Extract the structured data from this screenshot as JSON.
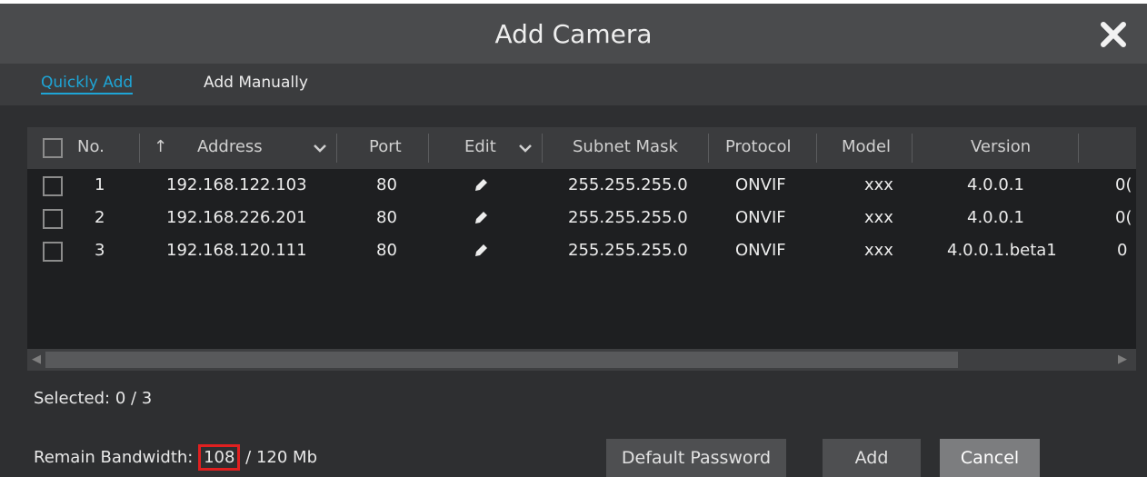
{
  "dialog": {
    "title": "Add Camera"
  },
  "tabs": [
    {
      "label": "Quickly Add"
    },
    {
      "label": "Add Manually"
    }
  ],
  "table": {
    "columns": [
      "No.",
      "Address",
      "Port",
      "Edit",
      "Subnet Mask",
      "Protocol",
      "Model",
      "Version"
    ],
    "sort_indicator": "↑",
    "rows": [
      {
        "no": "1",
        "address": "192.168.122.103",
        "port": "80",
        "subnet": "255.255.255.0",
        "protocol": "ONVIF",
        "model": "xxx",
        "version": "4.0.0.1",
        "overflow": "0("
      },
      {
        "no": "2",
        "address": "192.168.226.201",
        "port": "80",
        "subnet": "255.255.255.0",
        "protocol": "ONVIF",
        "model": "xxx",
        "version": "4.0.0.1",
        "overflow": "0("
      },
      {
        "no": "3",
        "address": "192.168.120.111",
        "port": "80",
        "subnet": "255.255.255.0",
        "protocol": "ONVIF",
        "model": "xxx",
        "version": "4.0.0.1.beta1",
        "overflow": "0"
      }
    ]
  },
  "status": {
    "selected": "Selected: 0 / 3",
    "bandwidth_label": "Remain Bandwidth:",
    "bandwidth_remaining": "108",
    "bandwidth_total": " / 120 Mb"
  },
  "buttons": {
    "default_password": "Default Password",
    "add": "Add",
    "cancel": "Cancel"
  },
  "colors": {
    "accent": "#1ea5d6",
    "highlight": "#e02020"
  }
}
